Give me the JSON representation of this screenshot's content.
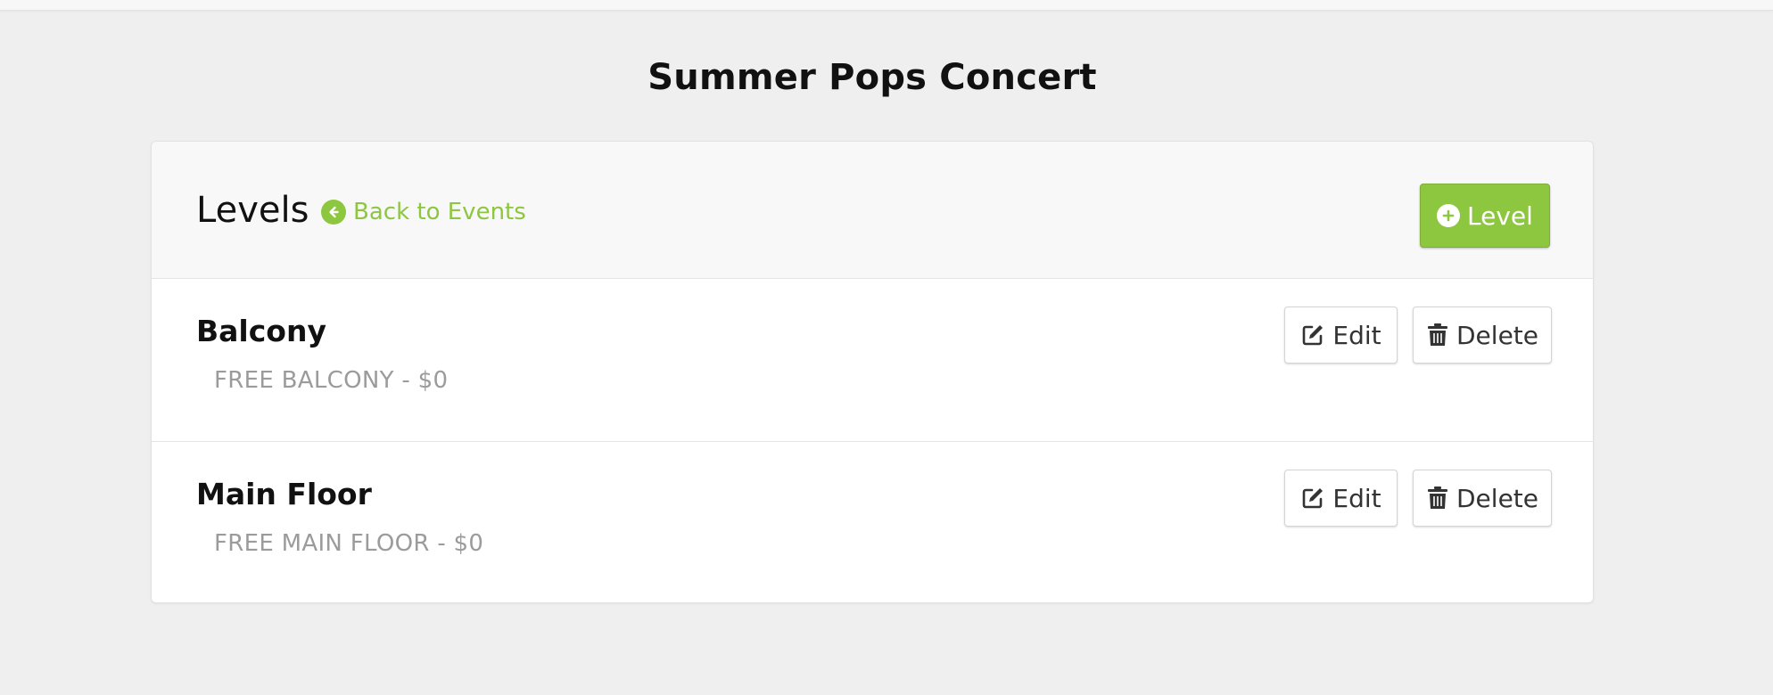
{
  "page": {
    "title": "Summer Pops Concert"
  },
  "header": {
    "title": "Levels",
    "back_link_label": "Back to Events",
    "add_button_label": "Level"
  },
  "levels": [
    {
      "name": "Balcony",
      "description": "FREE BALCONY - $0",
      "edit_label": "Edit",
      "delete_label": "Delete"
    },
    {
      "name": "Main Floor",
      "description": "FREE MAIN FLOOR - $0",
      "edit_label": "Edit",
      "delete_label": "Delete"
    }
  ],
  "colors": {
    "accent": "#8dc63f",
    "background": "#efefef",
    "muted_text": "#9b9b9b"
  },
  "icons": {
    "back": "arrow-circle-left-icon",
    "add": "plus-circle-icon",
    "edit": "edit-icon",
    "delete": "trash-icon"
  }
}
